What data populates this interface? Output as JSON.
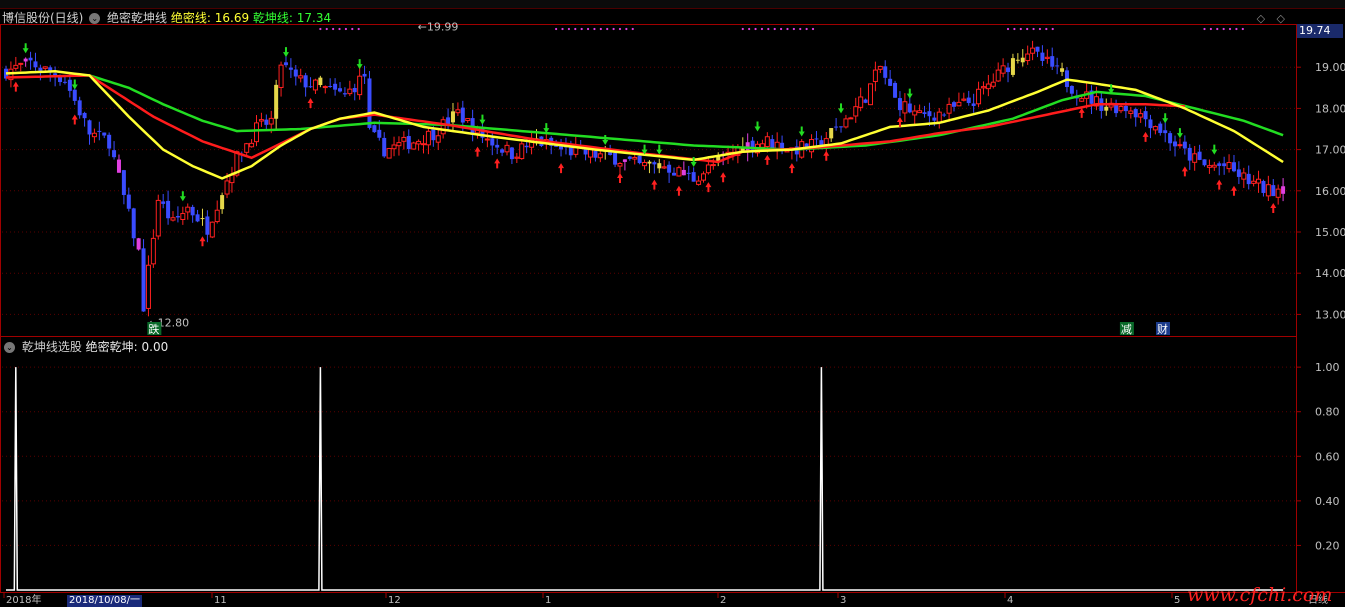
{
  "header": {
    "stock": "博信股份(日线)",
    "indicator": "绝密乾坤线",
    "line1_label": "绝密线: 16.69",
    "line2_label": "乾坤线: 17.34"
  },
  "sub_header": {
    "indicator": "乾坤线选股",
    "value_label": "绝密乾坤: 0.00"
  },
  "price_box": "19.74",
  "annotations": {
    "high": "19.99",
    "low": "12.80"
  },
  "tags": [
    "跌",
    "减",
    "财"
  ],
  "top_right": "◇ ◇",
  "watermark": "www.cfchi.com",
  "date_box": "2018/10/08/一",
  "colors": {
    "up": "#ff2020",
    "down": "#3a4cff",
    "yellow": "#e6d84a",
    "magenta": "#e040e0",
    "ma_short": "#ffff33",
    "ma_mid": "#ff1c1c",
    "ma_long": "#22dd22",
    "grid": "#5a0000",
    "axis": "#a00000",
    "text": "#c0c0c0"
  },
  "chart_data": [
    {
      "type": "candlestick",
      "title": "",
      "ylim": [
        12.5,
        20.0
      ],
      "yticks": [
        "19.00",
        "18.00",
        "17.00",
        "16.00",
        "15.00",
        "14.00",
        "13.00"
      ],
      "ytick_values": [
        19,
        18,
        17,
        16,
        15,
        14,
        13
      ],
      "x_labels": [
        "2018年",
        "11",
        "12",
        "1",
        "2",
        "3",
        "4",
        "5",
        "日线"
      ],
      "anchors": [
        [
          0,
          18.9
        ],
        [
          5,
          19.1
        ],
        [
          12,
          18.7
        ],
        [
          17,
          17.4
        ],
        [
          21,
          17.2
        ],
        [
          27,
          14.5
        ],
        [
          28,
          13.2
        ],
        [
          31,
          15.8
        ],
        [
          34,
          15.2
        ],
        [
          37,
          15.6
        ],
        [
          41,
          15.1
        ],
        [
          44,
          16.0
        ],
        [
          47,
          16.8
        ],
        [
          51,
          17.5
        ],
        [
          54,
          17.7
        ],
        [
          56,
          19.1
        ],
        [
          59,
          18.7
        ],
        [
          64,
          18.5
        ],
        [
          69,
          18.3
        ],
        [
          73,
          18.8
        ],
        [
          74,
          17.4
        ],
        [
          77,
          17.0
        ],
        [
          83,
          17.2
        ],
        [
          87,
          17.4
        ],
        [
          92,
          17.9
        ],
        [
          96,
          17.4
        ],
        [
          103,
          16.9
        ],
        [
          108,
          17.2
        ],
        [
          113,
          17.0
        ],
        [
          118,
          16.9
        ],
        [
          124,
          16.8
        ],
        [
          129,
          16.6
        ],
        [
          134,
          16.6
        ],
        [
          140,
          16.3
        ],
        [
          145,
          16.7
        ],
        [
          150,
          17.1
        ],
        [
          155,
          17.2
        ],
        [
          160,
          17.0
        ],
        [
          165,
          17.1
        ],
        [
          170,
          17.6
        ],
        [
          175,
          18.3
        ],
        [
          178,
          19.0
        ],
        [
          181,
          18.2
        ],
        [
          186,
          17.8
        ],
        [
          191,
          17.9
        ],
        [
          197,
          18.2
        ],
        [
          202,
          18.8
        ],
        [
          206,
          19.3
        ],
        [
          208,
          19.4
        ],
        [
          213,
          19.0
        ],
        [
          218,
          18.4
        ],
        [
          223,
          18.1
        ],
        [
          229,
          18.0
        ],
        [
          234,
          17.6
        ],
        [
          239,
          17.0
        ],
        [
          244,
          16.6
        ],
        [
          248,
          16.6
        ],
        [
          252,
          16.3
        ],
        [
          257,
          16.0
        ],
        [
          260,
          16.1
        ]
      ],
      "ma_short_anchors": [
        [
          0,
          18.85
        ],
        [
          10,
          18.9
        ],
        [
          17,
          18.8
        ],
        [
          25,
          17.8
        ],
        [
          32,
          17.0
        ],
        [
          38,
          16.6
        ],
        [
          44,
          16.3
        ],
        [
          50,
          16.6
        ],
        [
          56,
          17.1
        ],
        [
          62,
          17.5
        ],
        [
          68,
          17.75
        ],
        [
          75,
          17.9
        ],
        [
          85,
          17.55
        ],
        [
          100,
          17.3
        ],
        [
          120,
          17.0
        ],
        [
          140,
          16.75
        ],
        [
          150,
          16.95
        ],
        [
          160,
          17.0
        ],
        [
          170,
          17.15
        ],
        [
          180,
          17.55
        ],
        [
          190,
          17.65
        ],
        [
          200,
          17.95
        ],
        [
          210,
          18.4
        ],
        [
          216,
          18.7
        ],
        [
          222,
          18.6
        ],
        [
          230,
          18.45
        ],
        [
          240,
          18.0
        ],
        [
          250,
          17.45
        ],
        [
          260,
          16.7
        ]
      ],
      "ma_mid_anchors": [
        [
          0,
          18.75
        ],
        [
          17,
          18.8
        ],
        [
          30,
          17.8
        ],
        [
          40,
          17.2
        ],
        [
          50,
          16.8
        ],
        [
          56,
          17.15
        ],
        [
          62,
          17.5
        ],
        [
          68,
          17.75
        ],
        [
          75,
          17.85
        ],
        [
          90,
          17.6
        ],
        [
          110,
          17.2
        ],
        [
          130,
          16.9
        ],
        [
          145,
          16.7
        ],
        [
          150,
          16.95
        ],
        [
          165,
          17.05
        ],
        [
          180,
          17.2
        ],
        [
          190,
          17.4
        ],
        [
          200,
          17.55
        ],
        [
          210,
          17.8
        ],
        [
          222,
          18.1
        ],
        [
          232,
          18.1
        ],
        [
          240,
          18.05
        ]
      ],
      "ma_long_anchors": [
        [
          17,
          18.8
        ],
        [
          25,
          18.5
        ],
        [
          32,
          18.1
        ],
        [
          40,
          17.7
        ],
        [
          47,
          17.45
        ],
        [
          60,
          17.5
        ],
        [
          75,
          17.65
        ],
        [
          90,
          17.6
        ],
        [
          105,
          17.45
        ],
        [
          120,
          17.3
        ],
        [
          140,
          17.1
        ],
        [
          160,
          17.0
        ],
        [
          175,
          17.1
        ],
        [
          190,
          17.35
        ],
        [
          205,
          17.75
        ],
        [
          215,
          18.2
        ],
        [
          222,
          18.4
        ],
        [
          232,
          18.3
        ],
        [
          242,
          18.0
        ],
        [
          252,
          17.7
        ],
        [
          260,
          17.35
        ]
      ]
    },
    {
      "type": "line",
      "title": "",
      "ylim": [
        0.0,
        1.05
      ],
      "yticks": [
        "1.00",
        "0.80",
        "0.60",
        "0.40",
        "0.20"
      ],
      "ytick_values": [
        1.0,
        0.8,
        0.6,
        0.4,
        0.2
      ],
      "spikes_at": [
        2,
        64,
        166
      ],
      "values_baseline": 0.0,
      "spike_value": 1.0
    }
  ]
}
